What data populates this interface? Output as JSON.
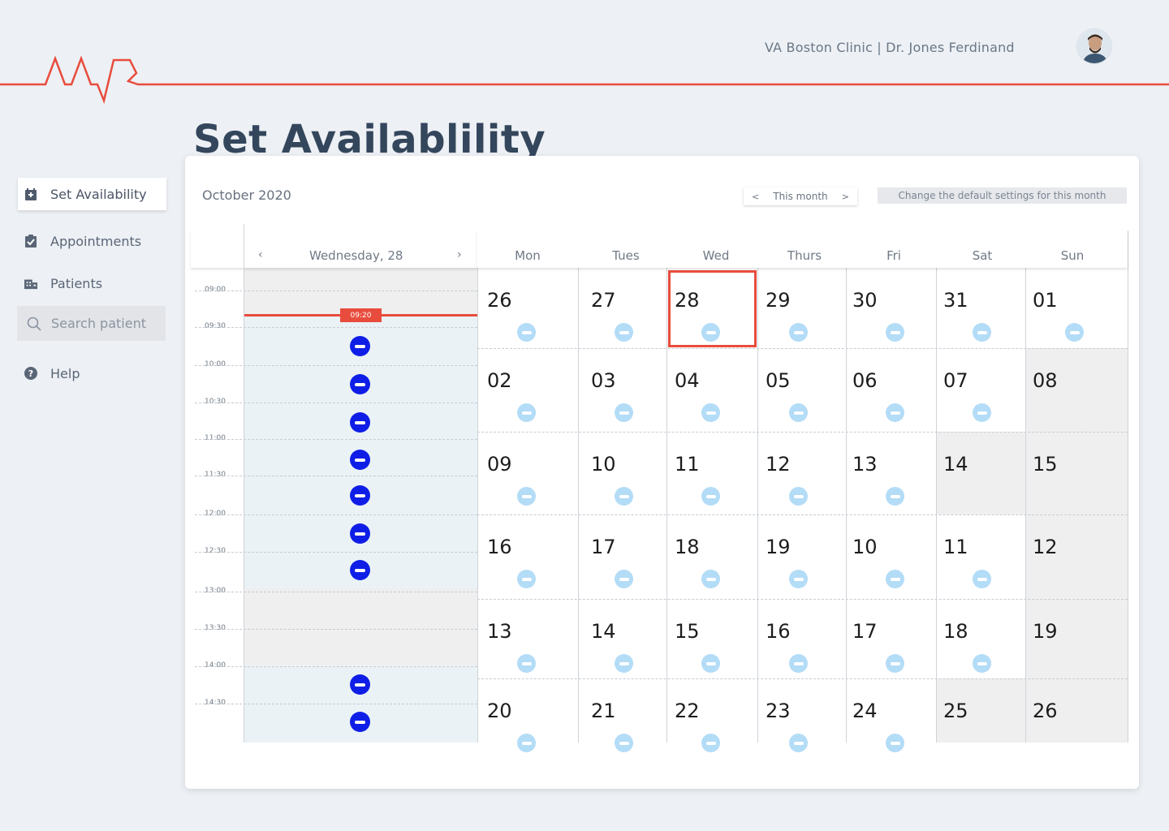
{
  "header": {
    "info": "VA Boston Clinic | Dr. Jones Ferdinand"
  },
  "page_title": "Set Availablility",
  "sidebar": {
    "items": [
      {
        "label": "Set Availability",
        "icon": "calendar-icon"
      },
      {
        "label": "Appointments",
        "icon": "clipboard-icon"
      },
      {
        "label": "Patients",
        "icon": "building-icon"
      },
      {
        "label": "Help",
        "icon": "help-icon"
      }
    ],
    "search_placeholder": "Search patient"
  },
  "calendar": {
    "month_label": "October 2020",
    "nav_label": "This month",
    "prev": "<",
    "next": ">",
    "settings_button": "Change the default settings for this month",
    "day_view": {
      "title": "Wednesday, 28",
      "prev": "‹",
      "next": "›",
      "now_tag": "09:20",
      "times": [
        "09:00",
        "09:30",
        "10:00",
        "10:30",
        "11:00",
        "11:30",
        "12:00",
        "12:30",
        "13:00",
        "13:30",
        "14:00",
        "14:30"
      ]
    },
    "weekdays": [
      "Mon",
      "Tues",
      "Wed",
      "Thurs",
      "Fri",
      "Sat",
      "Sun"
    ],
    "weeks": [
      [
        "26",
        "27",
        "28",
        "29",
        "30",
        "31",
        "01"
      ],
      [
        "02",
        "03",
        "04",
        "05",
        "06",
        "07",
        "08"
      ],
      [
        "09",
        "10",
        "11",
        "12",
        "13",
        "14",
        "15"
      ],
      [
        "16",
        "17",
        "18",
        "19",
        "10",
        "11",
        "12"
      ],
      [
        "13",
        "14",
        "15",
        "16",
        "17",
        "18",
        "19"
      ],
      [
        "20",
        "21",
        "22",
        "23",
        "24",
        "25",
        "26"
      ]
    ]
  },
  "colors": {
    "accent": "#e84c3d",
    "slot_button": "#0f1ee6",
    "available_dot": "#b3dcf7"
  }
}
